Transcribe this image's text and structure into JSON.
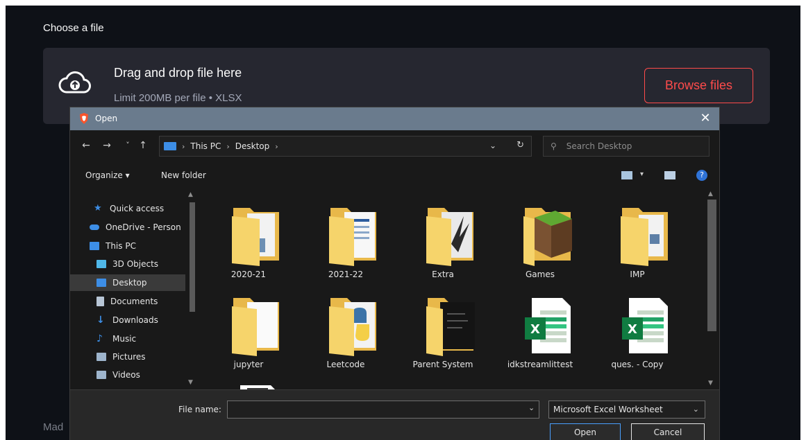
{
  "page": {
    "choose_label": "Choose a file",
    "made_with": "Mad"
  },
  "uploader": {
    "title": "Drag and drop file here",
    "subtitle": "Limit 200MB per file • XLSX",
    "browse_label": "Browse files",
    "cloud_icon": "cloud-upload-icon"
  },
  "dialog": {
    "title": "Open",
    "close_glyph": "✕",
    "nav": {
      "back": "←",
      "forward": "→",
      "recent": "˅",
      "up": "↑"
    },
    "breadcrumbs": [
      "This PC",
      "Desktop"
    ],
    "search_placeholder": "Search Desktop",
    "toolbar": {
      "organize": "Organize ▾",
      "new_folder": "New folder",
      "view_caret": "▾",
      "help": "?"
    },
    "sidebar": [
      {
        "label": "Quick access",
        "icon": "star-icon",
        "color": "#3d8ee6"
      },
      {
        "label": "OneDrive - Person",
        "icon": "cloud-icon",
        "color": "#3d8ee6"
      },
      {
        "label": "This PC",
        "icon": "pc-icon",
        "color": "#3d8ee6"
      },
      {
        "label": "3D Objects",
        "icon": "cube-icon",
        "color": "#4fb7e8"
      },
      {
        "label": "Desktop",
        "icon": "desktop-icon",
        "color": "#3d8ee6"
      },
      {
        "label": "Documents",
        "icon": "document-icon",
        "color": "#b8c6d6"
      },
      {
        "label": "Downloads",
        "icon": "download-icon",
        "color": "#3d8ee6"
      },
      {
        "label": "Music",
        "icon": "music-icon",
        "color": "#3d8ee6"
      },
      {
        "label": "Pictures",
        "icon": "pictures-icon",
        "color": "#9db4cc"
      },
      {
        "label": "Videos",
        "icon": "videos-icon",
        "color": "#9db4cc"
      }
    ],
    "files": [
      {
        "label": "2020-21",
        "type": "folder"
      },
      {
        "label": "2021-22",
        "type": "folder"
      },
      {
        "label": "Extra",
        "type": "folder"
      },
      {
        "label": "Games",
        "type": "folder"
      },
      {
        "label": "IMP",
        "type": "folder"
      },
      {
        "label": "jupyter",
        "type": "folder"
      },
      {
        "label": "Leetcode",
        "type": "folder"
      },
      {
        "label": "Parent System",
        "type": "folder"
      },
      {
        "label": "idkstreamlittest",
        "type": "excel"
      },
      {
        "label": "ques. - Copy",
        "type": "excel"
      },
      {
        "label": "",
        "type": "file"
      }
    ],
    "file_name_label": "File name:",
    "file_name_value": "",
    "file_type": "Microsoft Excel Worksheet",
    "open_label": "Open",
    "cancel_label": "Cancel"
  },
  "colors": {
    "app_bg": "#0e1117",
    "accent": "#ff4b4b",
    "dialog_titlebar": "#6a7b8d",
    "folder": "#f6d46b"
  }
}
